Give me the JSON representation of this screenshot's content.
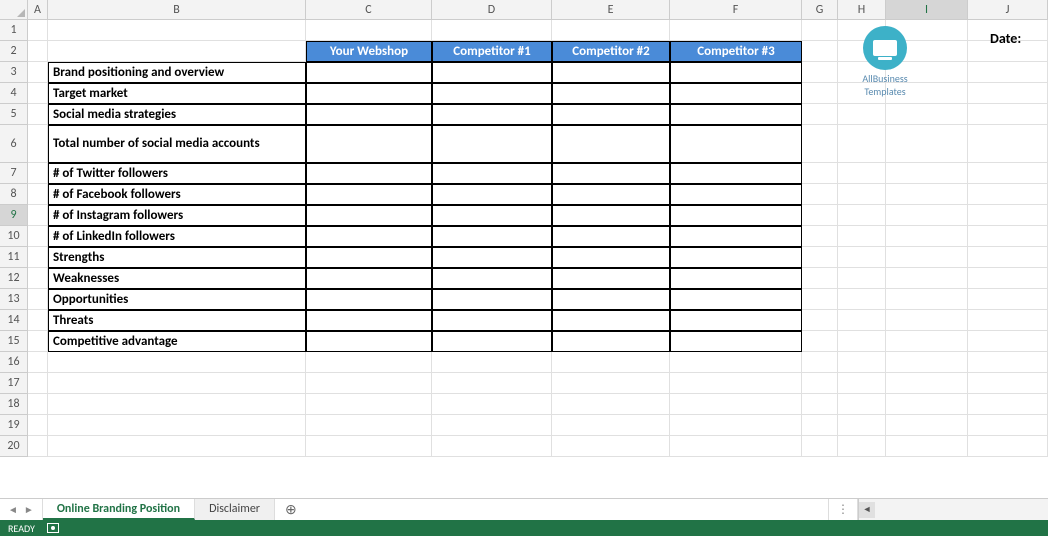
{
  "columns": [
    "A",
    "B",
    "C",
    "D",
    "E",
    "F",
    "G",
    "H",
    "I",
    "J"
  ],
  "row_numbers": [
    "1",
    "2",
    "3",
    "4",
    "5",
    "6",
    "7",
    "8",
    "9",
    "10",
    "11",
    "12",
    "13",
    "14",
    "15",
    "16",
    "17",
    "18",
    "19",
    "20"
  ],
  "selected_row": "9",
  "selected_col": "I",
  "header_row": {
    "c": "Your Webshop",
    "d": "Competitor #1",
    "e": "Competitor #2",
    "f": "Competitor #3"
  },
  "criteria": [
    "Brand positioning and overview",
    "Target market",
    "Social media strategies",
    "Total number of social media accounts",
    "# of Twitter followers",
    "# of Facebook followers",
    "# of Instagram followers",
    "# of LinkedIn followers",
    "Strengths",
    "Weaknesses",
    "Opportunities",
    "Threats",
    "Competitive advantage"
  ],
  "logo": {
    "line1": "AllBusiness",
    "line2": "Templates"
  },
  "date_label": "Date:",
  "tabs": {
    "active": "Online Branding Position",
    "other": "Disclaimer"
  },
  "status": "READY",
  "chart_data": {
    "type": "table",
    "title": "Online Branding Position",
    "columns": [
      "",
      "Your Webshop",
      "Competitor #1",
      "Competitor #2",
      "Competitor #3"
    ],
    "rows": [
      [
        "Brand positioning and overview",
        "",
        "",
        "",
        ""
      ],
      [
        "Target market",
        "",
        "",
        "",
        ""
      ],
      [
        "Social media strategies",
        "",
        "",
        "",
        ""
      ],
      [
        "Total number of social media accounts",
        "",
        "",
        "",
        ""
      ],
      [
        "# of Twitter followers",
        "",
        "",
        "",
        ""
      ],
      [
        "# of Facebook followers",
        "",
        "",
        "",
        ""
      ],
      [
        "# of Instagram followers",
        "",
        "",
        "",
        ""
      ],
      [
        "# of LinkedIn followers",
        "",
        "",
        "",
        ""
      ],
      [
        "Strengths",
        "",
        "",
        "",
        ""
      ],
      [
        "Weaknesses",
        "",
        "",
        "",
        ""
      ],
      [
        "Opportunities",
        "",
        "",
        "",
        ""
      ],
      [
        "Threats",
        "",
        "",
        "",
        ""
      ],
      [
        "Competitive advantage",
        "",
        "",
        "",
        ""
      ]
    ]
  }
}
